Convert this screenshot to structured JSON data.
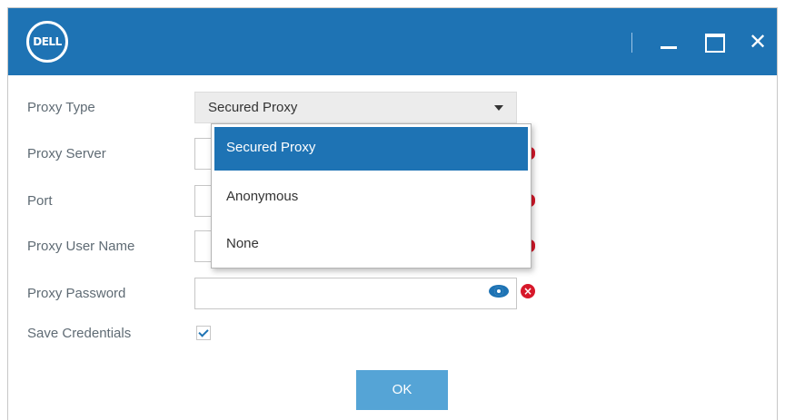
{
  "window": {
    "logo_text": "DELL",
    "controls": {
      "minimize": "minimize",
      "maximize": "maximize",
      "close": "✕"
    }
  },
  "form": {
    "proxy_type": {
      "label": "Proxy Type",
      "value": "Secured Proxy"
    },
    "proxy_server": {
      "label": "Proxy Server",
      "value": ""
    },
    "port": {
      "label": "Port",
      "value": ""
    },
    "proxy_user_name": {
      "label": "Proxy User Name",
      "value": ""
    },
    "proxy_password": {
      "label": "Proxy Password",
      "value": ""
    },
    "save_credentials": {
      "label": "Save Credentials",
      "checked": true
    }
  },
  "dropdown": {
    "options": [
      "Secured Proxy",
      "Anonymous",
      "None"
    ],
    "selected": "Secured Proxy"
  },
  "buttons": {
    "ok": "OK"
  },
  "colors": {
    "accent": "#1e73b4",
    "error": "#d7182a",
    "ok_button": "#55a4d6"
  },
  "icons": {
    "show_password": "eye-icon",
    "clear": "clear-icon",
    "check": "check-icon"
  }
}
